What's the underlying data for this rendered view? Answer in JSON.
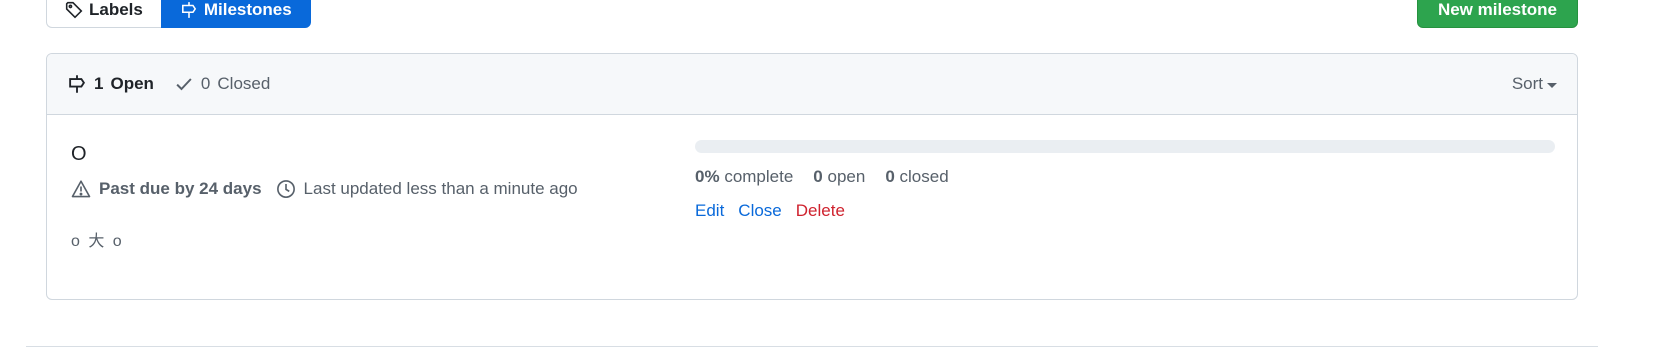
{
  "subnav": {
    "labels_label": "Labels",
    "milestones_label": "Milestones"
  },
  "new_milestone_label": "New milestone",
  "header": {
    "open_count": "1",
    "open_label": "Open",
    "closed_count": "0",
    "closed_label": "Closed",
    "sort_label": "Sort"
  },
  "milestone": {
    "title": "O",
    "due_text": "Past due by 24 days",
    "updated_text": "Last updated less than a minute ago",
    "description": "o 大 o",
    "progress_fraction": 0,
    "percent": "0%",
    "complete_label": "complete",
    "open_count": "0",
    "open_label": "open",
    "closed_count": "0",
    "closed_label": "closed",
    "actions": {
      "edit": "Edit",
      "close": "Close",
      "delete": "Delete"
    }
  },
  "colors": {
    "accent": "#0969da",
    "primary_button": "#2da44e",
    "danger": "#cf222e"
  }
}
